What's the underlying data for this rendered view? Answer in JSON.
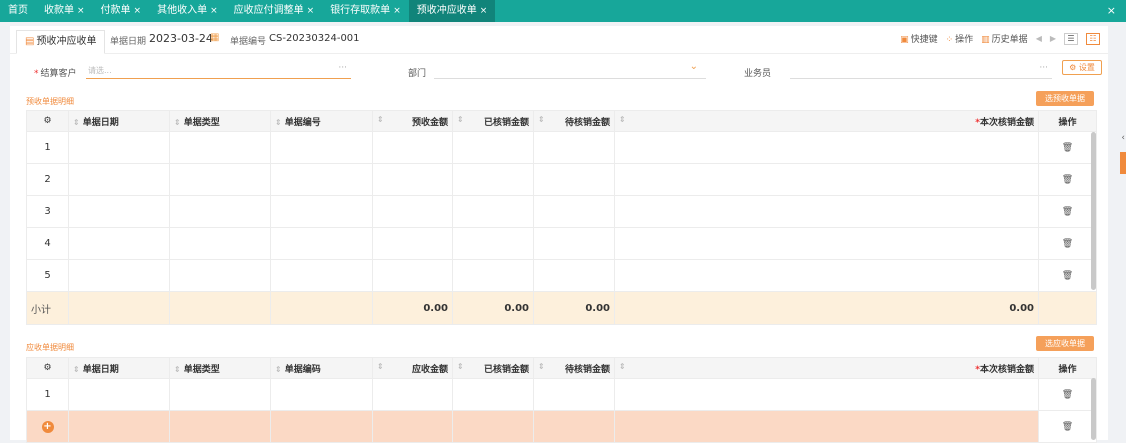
{
  "topbar": {
    "tabs": [
      {
        "label": "首页",
        "closable": false,
        "active": false
      },
      {
        "label": "收款单",
        "closable": true,
        "active": false
      },
      {
        "label": "付款单",
        "closable": true,
        "active": false
      },
      {
        "label": "其他收入单",
        "closable": true,
        "active": false
      },
      {
        "label": "应收应付调整单",
        "closable": true,
        "active": false
      },
      {
        "label": "银行存取款单",
        "closable": true,
        "active": false
      },
      {
        "label": "预收冲应收单",
        "closable": true,
        "active": true
      }
    ],
    "close_glyph": "×"
  },
  "header": {
    "doc_tab_label": "预收冲应收单",
    "date_label": "单据日期",
    "date_value": "2023-03-24",
    "number_label": "单据编号",
    "number_value": "CS-20230324-001",
    "shortcut_label": "快捷键",
    "operate_label": "操作",
    "history_label": "历史单据"
  },
  "form": {
    "customer_label": "结算客户",
    "customer_placeholder": "请选...",
    "dept_label": "部门",
    "salesman_label": "业务员",
    "settings_label": "设置",
    "more_glyph": "···"
  },
  "section1": {
    "title": "预收单据明细",
    "select_button": "选预收单据",
    "columns": [
      "单据日期",
      "单据类型",
      "单据编号",
      "预收金额",
      "已核销金额",
      "待核销金额",
      "",
      "本次核销金额",
      "操作"
    ],
    "rows": [
      "1",
      "2",
      "3",
      "4",
      "5"
    ],
    "subtotal": {
      "label": "小计",
      "prepay": "0.00",
      "written": "0.00",
      "pending": "0.00",
      "current": "0.00"
    }
  },
  "section2": {
    "title": "应收单据明细",
    "select_button": "选应收单据",
    "columns": [
      "单据日期",
      "单据类型",
      "单据编码",
      "应收金额",
      "已核销金额",
      "待核销金额",
      "",
      "本次核销金额",
      "操作"
    ],
    "rows": [
      "1"
    ]
  },
  "colors": {
    "teal": "#17a79a",
    "orange": "#f08a3c",
    "subtotal_bg": "#fdf0dc",
    "new_row_bg": "#fbd9c5"
  }
}
